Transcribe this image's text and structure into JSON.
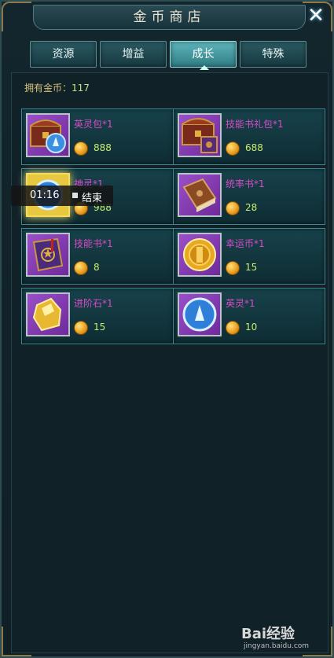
{
  "window": {
    "title": "金币商店",
    "close_symbol": "✕"
  },
  "tabs": [
    {
      "label": "资源",
      "active": false
    },
    {
      "label": "增益",
      "active": false
    },
    {
      "label": "成长",
      "active": true
    },
    {
      "label": "特殊",
      "active": false
    }
  ],
  "gold": {
    "label": "拥有金币：",
    "value": "117"
  },
  "items": [
    {
      "name": "英灵包*1",
      "price": "888",
      "icon": "treasure-chest-with-orb-icon",
      "highlighted": false
    },
    {
      "name": "技能书礼包*1",
      "price": "688",
      "icon": "treasure-chest-with-book-icon",
      "highlighted": false
    },
    {
      "name": "神灵*1",
      "price": "988",
      "icon": "blue-orb-icon",
      "highlighted": true
    },
    {
      "name": "统率书*1",
      "price": "28",
      "icon": "brown-book-icon",
      "highlighted": false
    },
    {
      "name": "技能书*1",
      "price": "8",
      "icon": "purple-spellbook-icon",
      "highlighted": false
    },
    {
      "name": "幸运币*1",
      "price": "15",
      "icon": "gold-coin-icon",
      "highlighted": false
    },
    {
      "name": "进阶石*1",
      "price": "15",
      "icon": "gold-stone-icon",
      "highlighted": false
    },
    {
      "name": "英灵*1",
      "price": "10",
      "icon": "blue-spirit-orb-icon",
      "highlighted": false
    }
  ],
  "recording_overlay": {
    "time": "01:16",
    "label": "结束"
  },
  "watermark": {
    "text": "Bai经验",
    "subtext": "jingyan.baidu.com"
  },
  "colors": {
    "accent": "#5fb6bc",
    "item_name": "#d94bc8",
    "price": "#c7ec6e",
    "gold_label": "#d6c27a"
  }
}
